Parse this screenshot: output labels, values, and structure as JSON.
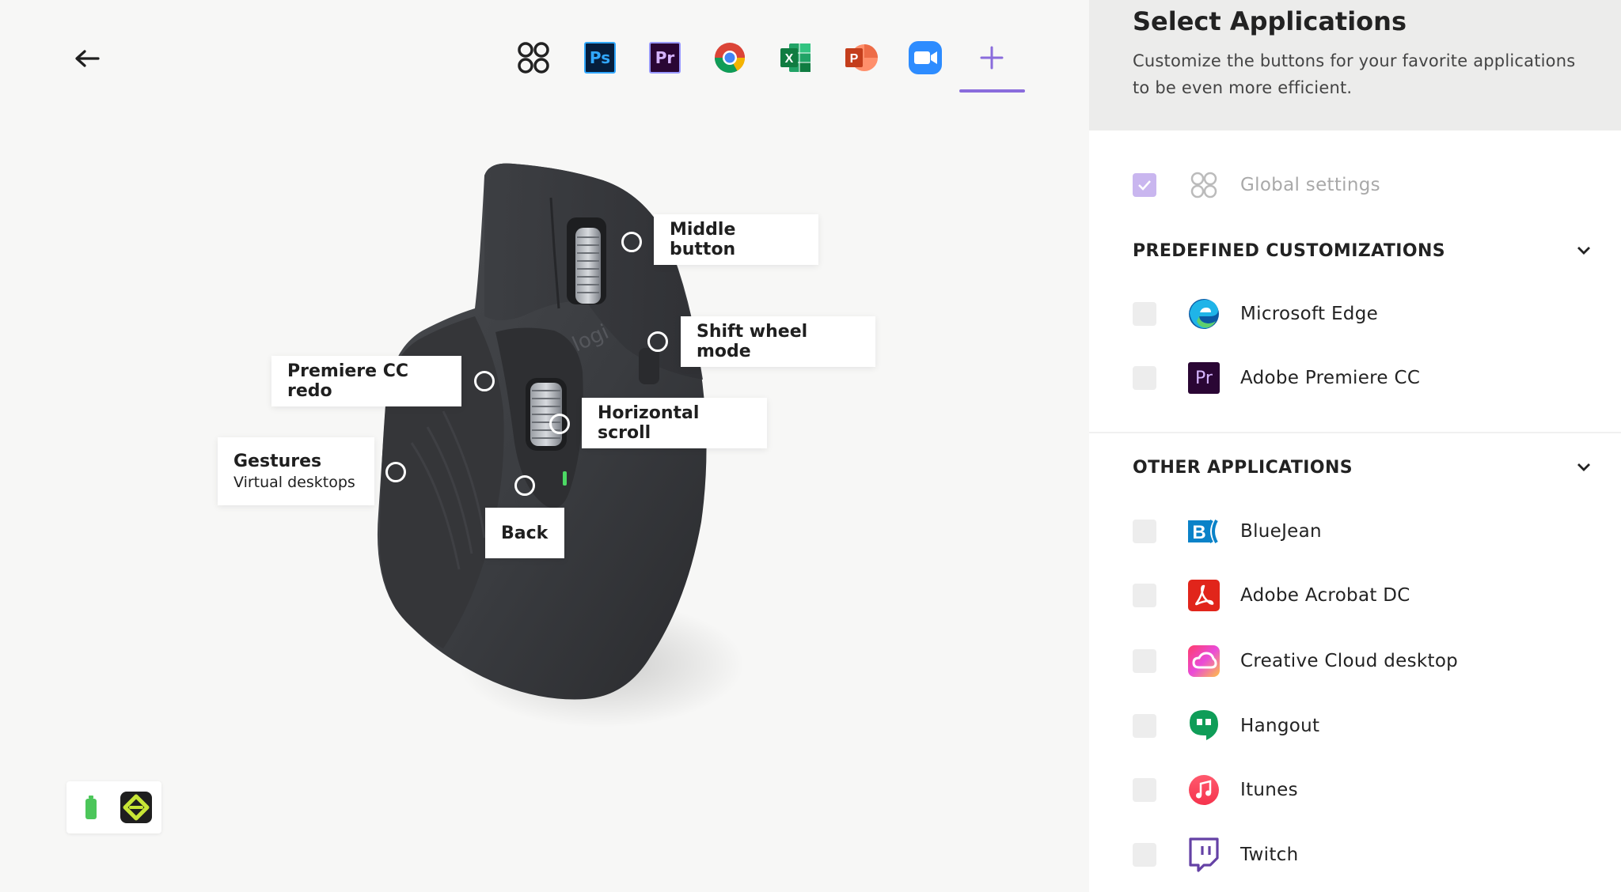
{
  "app_bar": {
    "items": [
      {
        "name": "global",
        "label": ""
      },
      {
        "name": "photoshop",
        "label": "Ps"
      },
      {
        "name": "premiere",
        "label": "Pr"
      },
      {
        "name": "chrome",
        "label": ""
      },
      {
        "name": "excel",
        "label": "X"
      },
      {
        "name": "powerpoint",
        "label": "P"
      },
      {
        "name": "zoom",
        "label": ""
      },
      {
        "name": "add",
        "label": "+"
      }
    ],
    "active": "add"
  },
  "callouts": {
    "middle_button": "Middle button",
    "shift_wheel_mode": "Shift wheel mode",
    "premiere_redo": "Premiere CC redo",
    "horizontal_scroll": "Horizontal scroll",
    "gestures_title": "Gestures",
    "gestures_sub": "Virtual desktops",
    "back": "Back"
  },
  "mouse": {
    "brand": "logi"
  },
  "panel": {
    "title": "Select Applications",
    "subtitle_line1": "Customize the buttons for your favorite applications",
    "subtitle_line2": "to be even more efficient.",
    "global_label": "Global settings",
    "predefined_title": "PREDEFINED CUSTOMIZATIONS",
    "predefined": [
      {
        "label": "Microsoft Edge",
        "icon": "edge-icon"
      },
      {
        "label": "Adobe Premiere CC",
        "icon": "premiere-icon",
        "short": "Pr"
      }
    ],
    "other_title": "OTHER APPLICATIONS",
    "other": [
      {
        "label": "BlueJean",
        "icon": "bluejeans-icon",
        "short": "B"
      },
      {
        "label": "Adobe Acrobat DC",
        "icon": "acrobat-icon"
      },
      {
        "label": "Creative Cloud desktop",
        "icon": "creative-cloud-icon"
      },
      {
        "label": "Hangout",
        "icon": "hangouts-icon"
      },
      {
        "label": "Itunes",
        "icon": "itunes-icon"
      },
      {
        "label": "Twitch",
        "icon": "twitch-icon"
      }
    ]
  },
  "colors": {
    "accent": "#8a6cdc",
    "checkbox_checked": "#c9b6ef",
    "battery": "#4cc65a",
    "flow_bg": "#1f1f1f",
    "flow_fg": "#c8e636"
  }
}
